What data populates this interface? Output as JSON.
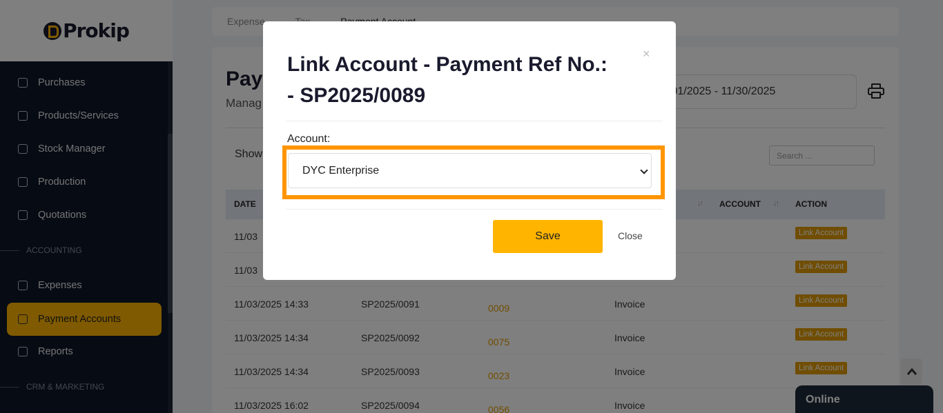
{
  "app": {
    "logo_text": "Prokip"
  },
  "sidebar": {
    "items": [
      {
        "label": "Purchases",
        "icon": "box-icon"
      },
      {
        "label": "Products/Services",
        "icon": "cube-icon"
      },
      {
        "label": "Stock Manager",
        "icon": "folder-icon"
      },
      {
        "label": "Production",
        "icon": "factory-icon"
      },
      {
        "label": "Quotations",
        "icon": "clipboard-icon"
      },
      {
        "label": "Expenses",
        "icon": "pie-icon"
      },
      {
        "label": "Payment Accounts",
        "icon": "wallet-icon"
      },
      {
        "label": "Reports",
        "icon": "monitor-icon"
      }
    ],
    "sections": {
      "accounting": "ACCOUNTING",
      "crm": "CRM & MARKETING"
    }
  },
  "tabs": [
    "Expense",
    "Tax",
    "Payment Account"
  ],
  "page": {
    "title": "Pay",
    "subtitle": "Manag",
    "date_range": "/01/2025 - 11/30/2025",
    "show_label": "Show",
    "search_placeholder": "Search ..."
  },
  "table": {
    "headers": {
      "date": "DATE",
      "account": "ACCOUNT",
      "action": "ACTION"
    },
    "rows": [
      {
        "date": "11/03",
        "ref": "",
        "num": "",
        "type": "",
        "action": "Link Account"
      },
      {
        "date": "11/03",
        "ref": "",
        "num": "",
        "type": "",
        "action": "Link Account"
      },
      {
        "date": "11/03/2025 14:33",
        "ref": "SP2025/0091",
        "num": "0009",
        "type": "Invoice",
        "action": "Link Account"
      },
      {
        "date": "11/03/2025 14:34",
        "ref": "SP2025/0092",
        "num": "0075",
        "type": "Invoice",
        "action": "Link Account"
      },
      {
        "date": "11/03/2025 14:34",
        "ref": "SP2025/0093",
        "num": "0023",
        "type": "Invoice",
        "action": "Link Account"
      },
      {
        "date": "11/03/2025 16:02",
        "ref": "SP2025/0094",
        "num": "0056",
        "type": "Invoice",
        "action": ""
      }
    ]
  },
  "chat": {
    "status": "Online"
  },
  "modal": {
    "title": "Link Account - Payment Ref No.: - SP2025/0089",
    "close_x": "×",
    "account_label": "Account:",
    "account_value": "DYC Enterprise",
    "save_label": "Save",
    "close_label": "Close"
  },
  "colors": {
    "accent": "#ffb400",
    "highlight": "#ff9500",
    "sidebar_bg": "#0d1628"
  }
}
